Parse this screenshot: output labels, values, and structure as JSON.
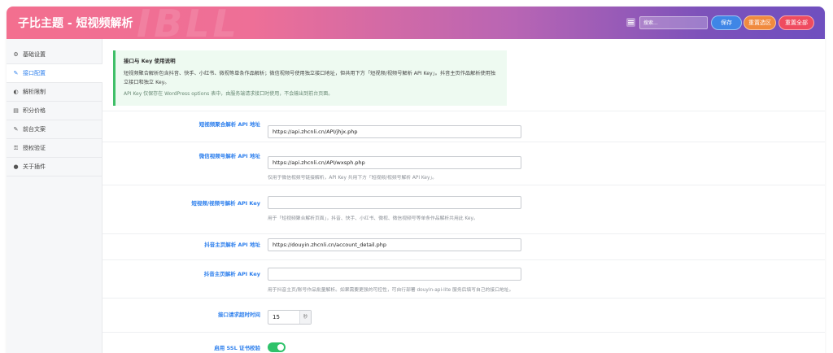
{
  "header": {
    "title": "子比主题 - 短视频解析",
    "watermark": "IBLL",
    "search_placeholder": "搜索...",
    "save_label": "保存",
    "reset_section_label": "重置选区",
    "reset_all_label": "重置全部",
    "colors": {
      "save": "#3f86e6",
      "reset_section": "#f08a3e",
      "reset_all": "#ef4b5f"
    }
  },
  "sidebar": {
    "items": [
      {
        "label": "基础设置",
        "icon": "gear-icon",
        "glyph": "⚙",
        "active": false
      },
      {
        "label": "接口配置",
        "icon": "plug-icon",
        "glyph": "✎",
        "active": true
      },
      {
        "label": "解析限制",
        "icon": "shield-icon",
        "glyph": "◐",
        "active": false
      },
      {
        "label": "积分价格",
        "icon": "database-icon",
        "glyph": "▤",
        "active": false
      },
      {
        "label": "前台文案",
        "icon": "pencil-icon",
        "glyph": "✎",
        "active": false
      },
      {
        "label": "授权验证",
        "icon": "key-icon",
        "glyph": "⚿",
        "active": false
      },
      {
        "label": "关于插件",
        "icon": "info-icon",
        "glyph": "●",
        "active": false
      }
    ]
  },
  "notice": {
    "title": "接口与 Key 使用说明",
    "text": "短视频聚合解析包含抖音、快手、小红书、微视等单条作品解析；微信视频号使用独立接口地址，但共用下方「短视频/视频号解析 API Key」。抖音主页作品解析使用独立接口和独立 Key。",
    "note": "API Key 仅保存在 WordPress options 表中，由服务端请求接口时使用，不会输出到前台页面。"
  },
  "fields": {
    "aggregate_url": {
      "label": "短视频聚合解析 API 地址",
      "value": "https://api.zhcnli.cn/API/jhjx.php"
    },
    "wechat_url": {
      "label": "微信视频号解析 API 地址",
      "value": "https://api.zhcnli.cn/API/wxsph.php",
      "desc": "仅用于微信视频号链接解析，API Key 共用下方「短视频/视频号解析 API Key」。"
    },
    "shortvideo_key": {
      "label": "短视频/视频号解析 API Key",
      "value": "",
      "desc": "用于「短视频聚合解析页面」，抖音、快手、小红书、微视、微信视频号等单条作品解析共用此 Key。"
    },
    "douyin_home_url": {
      "label": "抖音主页解析 API 地址",
      "value": "https://douyin.zhcnli.cn/account_detail.php"
    },
    "douyin_home_key": {
      "label": "抖音主页解析 API Key",
      "value": "",
      "desc": "用于抖音主页/账号作品批量解析。如果需要更强的可控性，可自行部署 douyin-api-lite 服务后填写自己的接口地址。"
    },
    "timeout": {
      "label": "接口请求超时时间",
      "value": "15",
      "unit": "秒"
    },
    "ssl": {
      "label": "启用 SSL 证书校验",
      "enabled": true
    }
  }
}
